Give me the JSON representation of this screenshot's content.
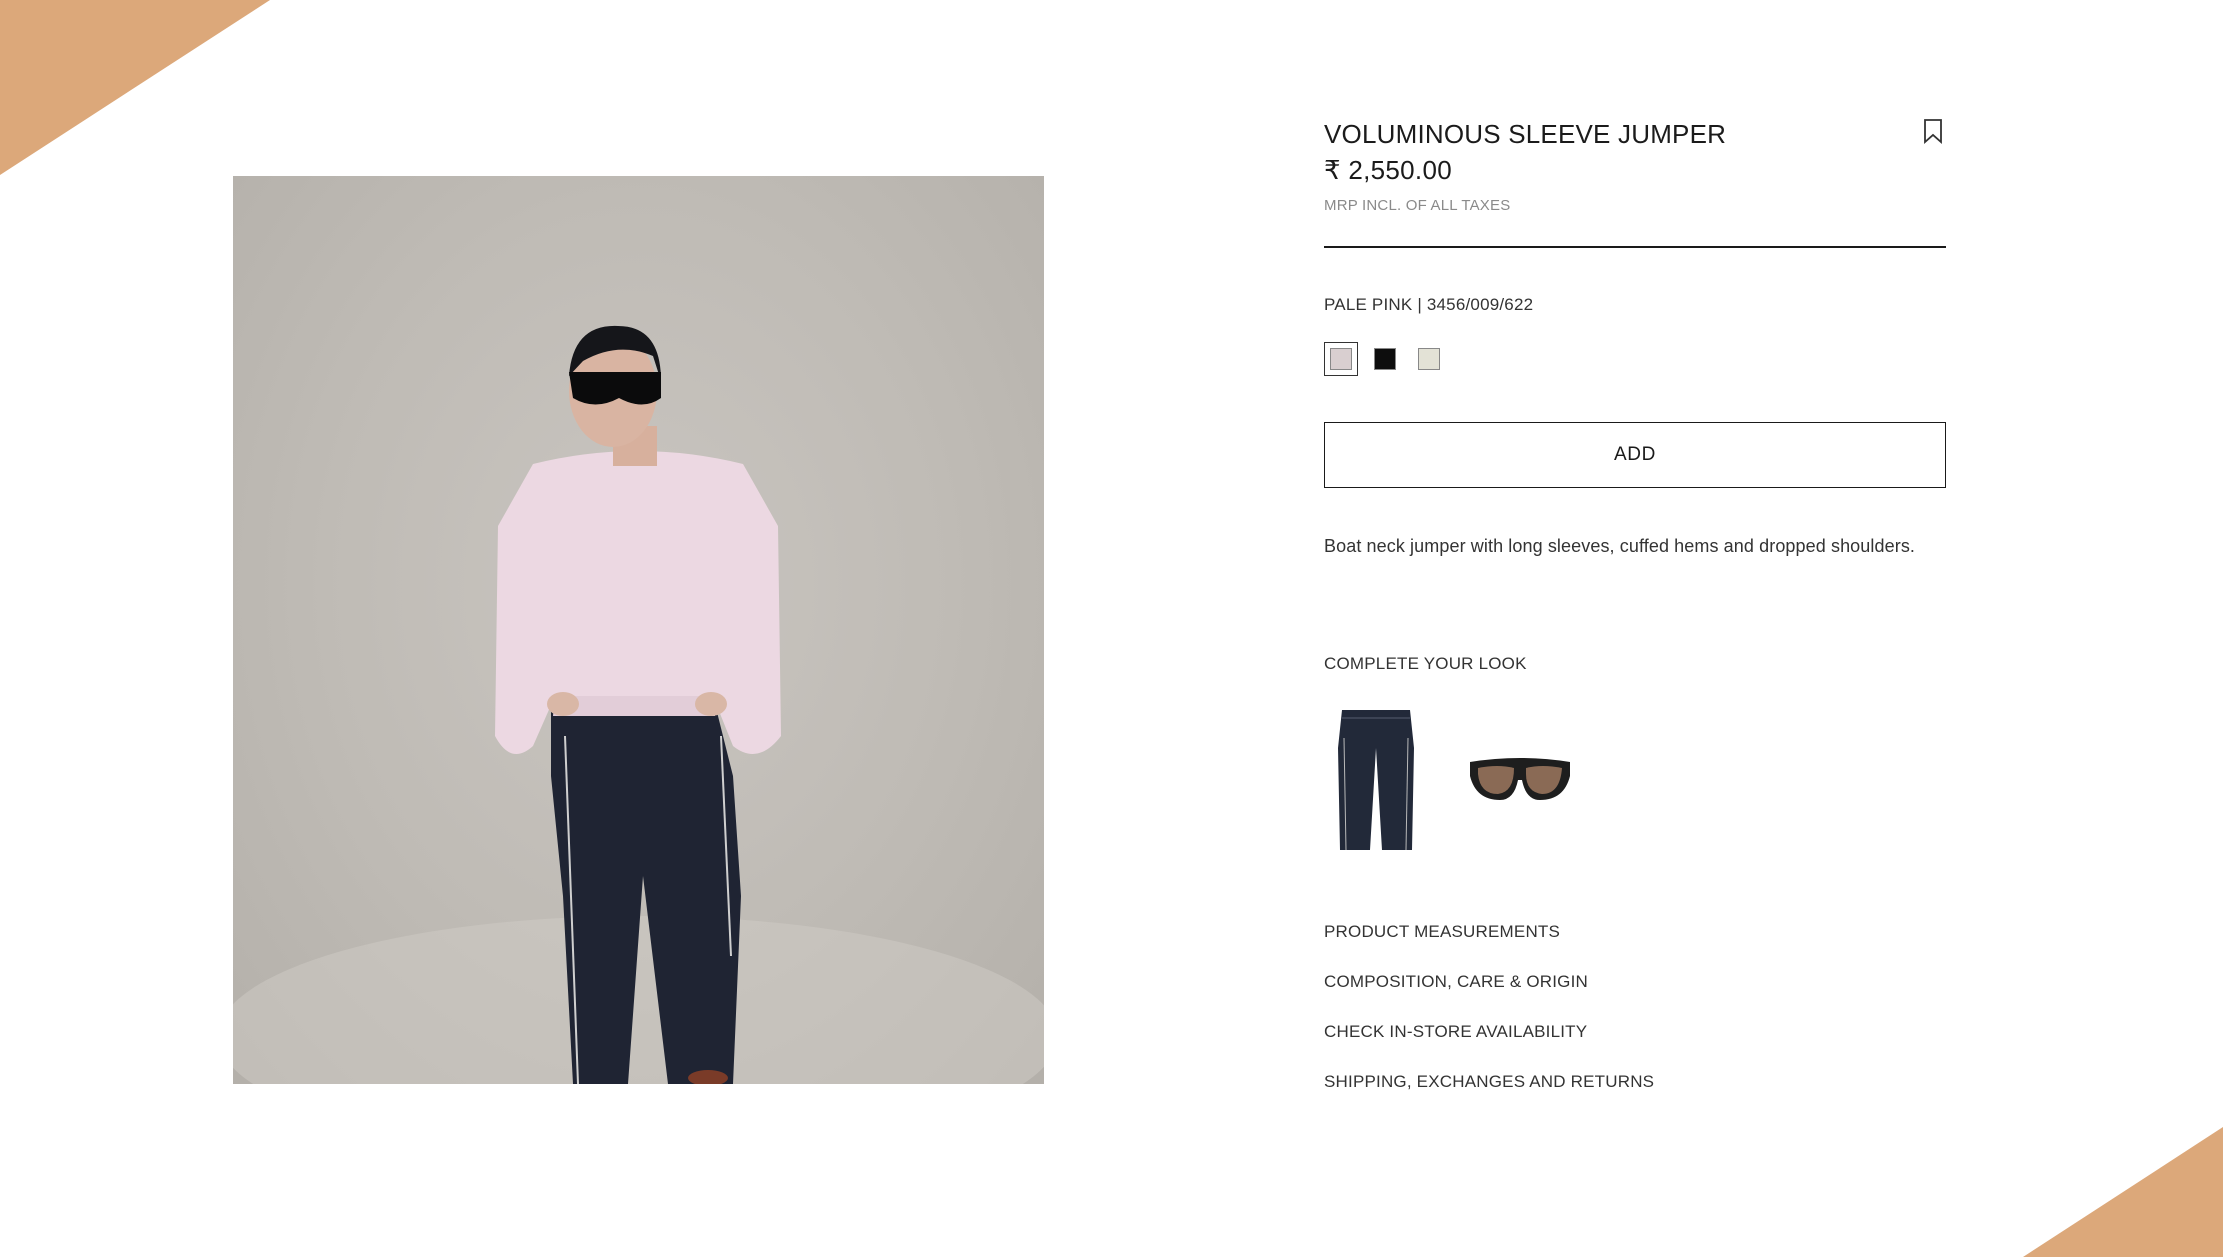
{
  "product": {
    "title": "VOLUMINOUS SLEEVE JUMPER",
    "price": "₹ 2,550.00",
    "tax_note": "MRP INCL. OF ALL TAXES",
    "color_ref": "PALE PINK | 3456/009/622",
    "description": "Boat neck jumper with long sleeves, cuffed hems and dropped shoulders."
  },
  "swatches": [
    {
      "name": "pale-pink",
      "color": "#d9cfd0",
      "selected": true
    },
    {
      "name": "black",
      "color": "#0d0d0d",
      "selected": false
    },
    {
      "name": "ecru",
      "color": "#e3e2d6",
      "selected": false
    }
  ],
  "actions": {
    "add_label": "ADD",
    "bookmark_icon": "bookmark-icon"
  },
  "complete_look": {
    "title": "COMPLETE YOUR LOOK",
    "items": [
      {
        "name": "jeans",
        "icon": "jeans-thumbnail"
      },
      {
        "name": "sunglasses",
        "icon": "sunglasses-thumbnail"
      }
    ]
  },
  "info_links": [
    "PRODUCT MEASUREMENTS",
    "COMPOSITION, CARE & ORIGIN",
    "CHECK IN-STORE AVAILABILITY",
    "SHIPPING, EXCHANGES AND RETURNS"
  ],
  "colors": {
    "corner_accent": "#dca87a",
    "image_background": "#c2beb8"
  }
}
